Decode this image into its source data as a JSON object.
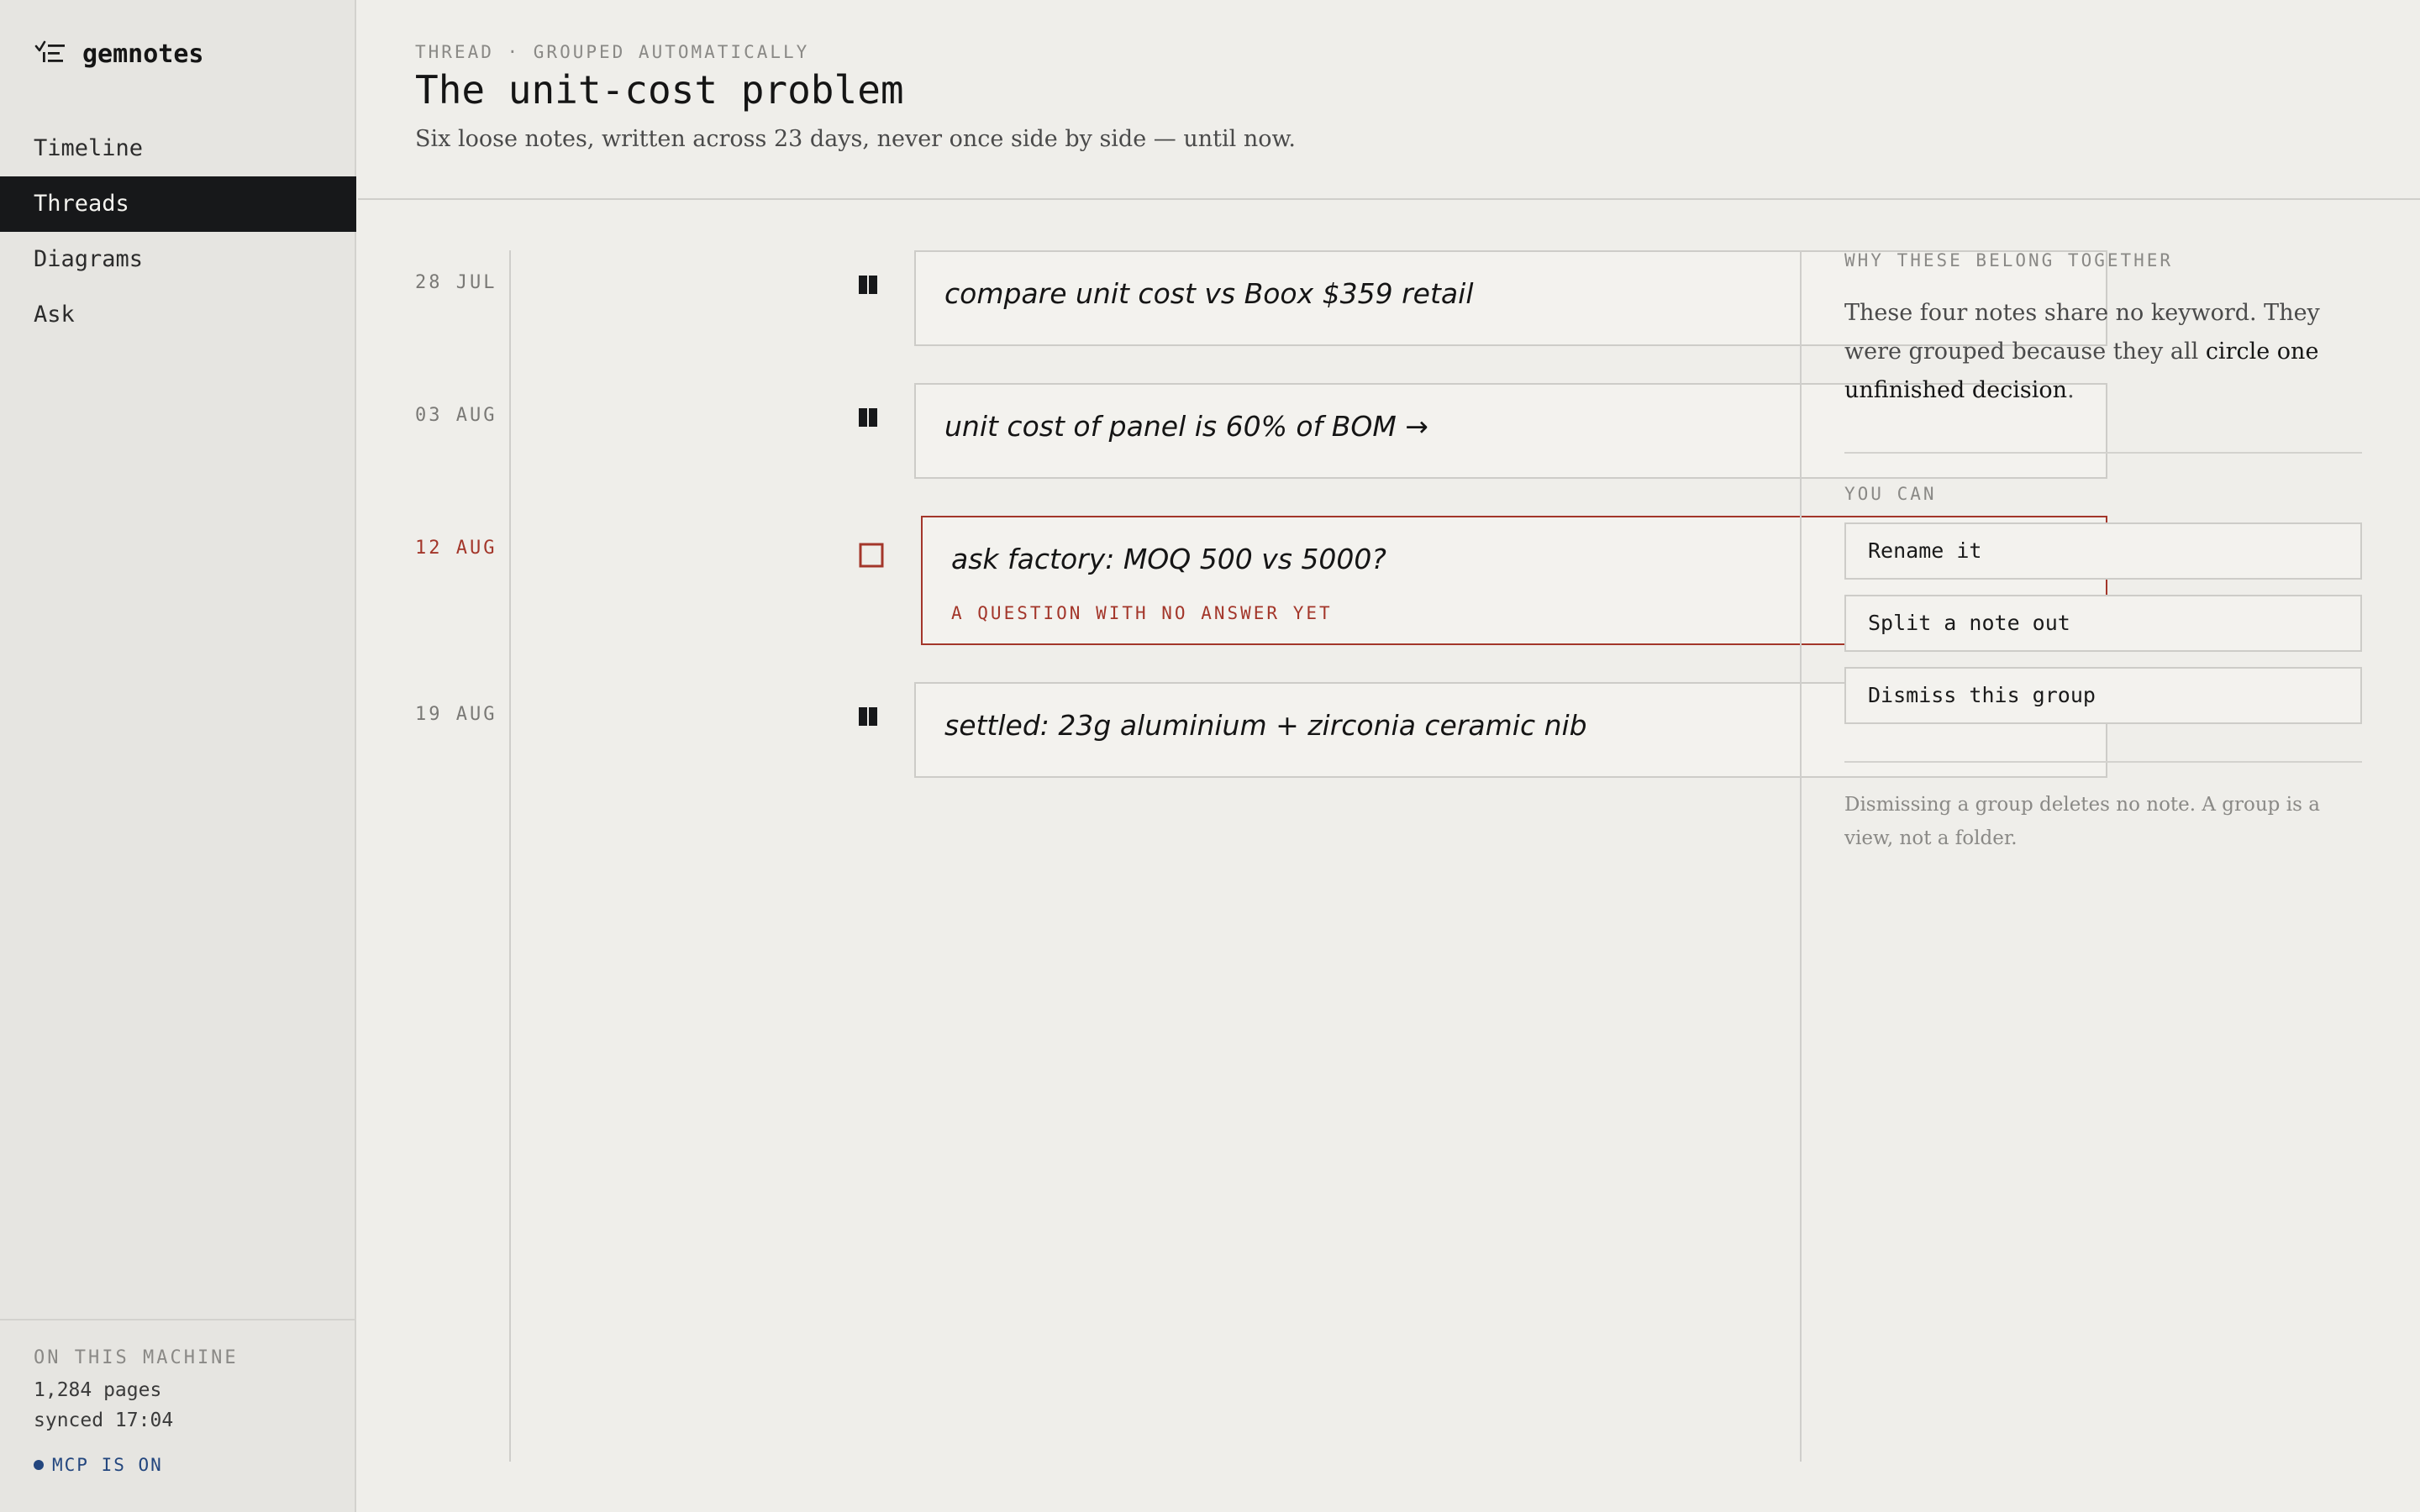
{
  "app": {
    "name": "gemnotes",
    "icon": "checklist-icon"
  },
  "nav": {
    "items": [
      {
        "label": "Timeline",
        "active": false
      },
      {
        "label": "Threads",
        "active": true
      },
      {
        "label": "Diagrams",
        "active": false
      },
      {
        "label": "Ask",
        "active": false
      }
    ]
  },
  "sidebar_footer": {
    "label": "ON THIS MACHINE",
    "pages": "1,284 pages",
    "synced": "synced 17:04",
    "mcp_status": "MCP IS ON",
    "mcp_color": "#23467e"
  },
  "header": {
    "eyebrow": "THREAD · GROUPED AUTOMATICALLY",
    "title": "The unit-cost problem",
    "subtitle": "Six loose notes, written across 23 days, never once side by side — until now."
  },
  "timeline": {
    "entries": [
      {
        "date": "28 JUL",
        "text": "compare unit cost vs Boox $359 retail",
        "status": "settled"
      },
      {
        "date": "03 AUG",
        "text": "unit cost of panel is 60% of BOM →",
        "status": "settled"
      },
      {
        "date": "12 AUG",
        "text": "ask factory: MOQ 500 vs 5000?",
        "status": "open",
        "note": "A QUESTION WITH NO ANSWER YET"
      },
      {
        "date": "19 AUG",
        "text": "settled: 23g aluminium + zirconia ceramic nib",
        "status": "settled"
      }
    ],
    "open_color": "#a3362a"
  },
  "panel": {
    "why_label": "WHY THESE BELONG TOGETHER",
    "why_text_before": "These four notes share no keyword. They were grouped because they all ",
    "why_text_emphasis": "circle one unfinished decision",
    "why_text_after": ".",
    "you_can_label": "YOU CAN",
    "actions": {
      "rename": "Rename it",
      "split": "Split a note out",
      "dismiss": "Dismiss this group"
    },
    "note": "Dismissing a group deletes no note. A group is a view, not a folder."
  }
}
